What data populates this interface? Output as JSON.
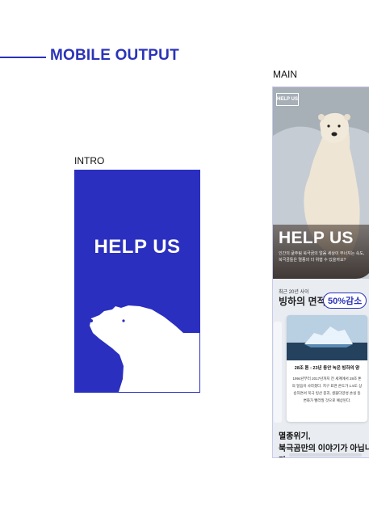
{
  "section_title": "MOBILE OUTPUT",
  "intro": {
    "label": "INTRO",
    "title": "HELP US",
    "bg_color": "#2a2fbf"
  },
  "main": {
    "label": "MAIN",
    "logo_text": "HELP US",
    "hero_title": "HELP US",
    "hero_desc": "인간의 굶주림 북극곰의 얼음 세상이 무너지는 속도, 북극곰들은 멸종의 더 위협 수 있을까요?",
    "small_label": "최근 20년 사이",
    "area_heading": "빙하의 면적",
    "badge": "50%감소",
    "card": {
      "title": "28조 톤 : 23년 동안 녹은 빙하의 양",
      "body": "1994년부터 2017년까지 전 세계에서 28조 톤의 얼음이 사라졌다. 지구 표면 온도가 1.5도 상승하면서 북극 빙산 붕괴, 생물다양성 손실 등 변화가 빨라질 것으로 예상된다."
    },
    "bottom_line1": "멸종위기,",
    "bottom_line2": "북극곰만의 이야기가 아닙니다"
  },
  "accent_color": "#2b33b8"
}
